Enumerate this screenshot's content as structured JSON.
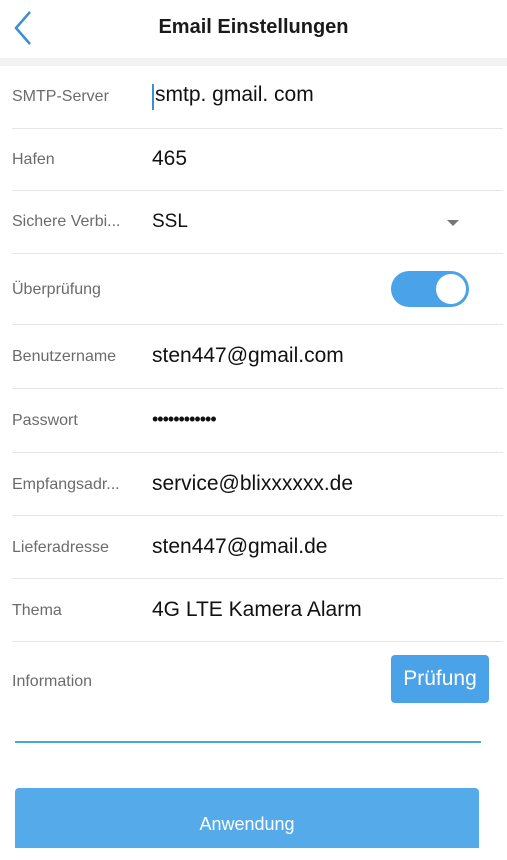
{
  "header": {
    "title": "Email Einstellungen",
    "back_icon": "chevron-left-icon"
  },
  "colors": {
    "accent": "#4aa3e8",
    "button": "#55aae9"
  },
  "fields": {
    "smtp_server": {
      "label": "SMTP-Server",
      "value": "smtp. gmail. com"
    },
    "port": {
      "label": "Hafen",
      "value": "465"
    },
    "secure_connection": {
      "label": "Sichere Verbi...",
      "value": "SSL"
    },
    "verification": {
      "label": "Überprüfung",
      "enabled": true
    },
    "username": {
      "label": "Benutzername",
      "value": "sten447@gmail.com"
    },
    "password": {
      "label": "Passwort",
      "value": "••••••••••••"
    },
    "recipient": {
      "label": "Empfangsadr...",
      "value": "service@blixxxxxx.de"
    },
    "sender": {
      "label": "Lieferadresse",
      "value": "sten447@gmail.de"
    },
    "subject": {
      "label": "Thema",
      "value": "4G LTE Kamera  Alarm"
    },
    "information": {
      "label": "Information",
      "value": ""
    }
  },
  "buttons": {
    "test_label": "Prüfung",
    "apply_label": "Anwendung"
  }
}
